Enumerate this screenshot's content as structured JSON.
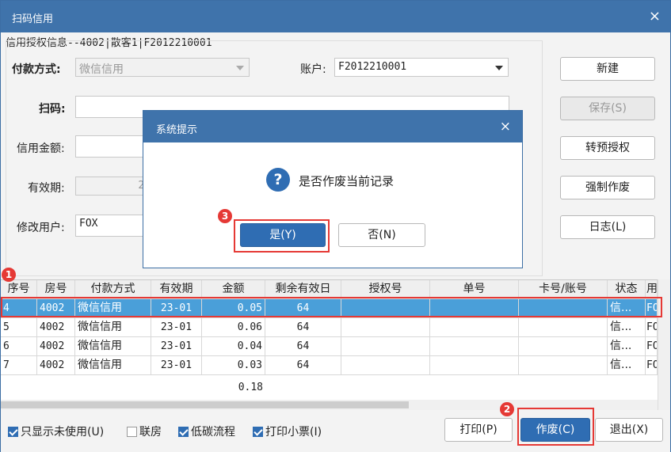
{
  "window": {
    "title": "扫码信用",
    "close": "×"
  },
  "subheader": "信用授权信息--4002|散客1|F2012210001",
  "form": {
    "pay_method_label": "付款方式:",
    "pay_method_value": "微信信用",
    "account_label": "账户:",
    "account_value": "F2012210001",
    "scan_label": "扫码:",
    "scan_value": "",
    "credit_amount_label": "信用金额:",
    "credit_amount_value": "",
    "validity_label": "有效期:",
    "validity_value": "20",
    "modify_user_label": "修改用户:",
    "modify_user_value": "FOX"
  },
  "side_buttons": {
    "new": "新建",
    "save": "保存(S)",
    "pre_auth": "转预授权",
    "force_void": "强制作废",
    "log": "日志(L)"
  },
  "grid": {
    "headers": [
      "序号",
      "房号",
      "付款方式",
      "有效期",
      "金额",
      "剩余有效日",
      "授权号",
      "单号",
      "卡号/账号",
      "状态",
      "用"
    ],
    "rows": [
      [
        "4",
        "4002",
        "微信信用",
        "23-01",
        "0.05",
        "64",
        "",
        "",
        "",
        "信...",
        "FO"
      ],
      [
        "5",
        "4002",
        "微信信用",
        "23-01",
        "0.06",
        "64",
        "",
        "",
        "",
        "信...",
        "FO"
      ],
      [
        "6",
        "4002",
        "微信信用",
        "23-01",
        "0.04",
        "64",
        "",
        "",
        "",
        "信...",
        "FO"
      ],
      [
        "7",
        "4002",
        "微信信用",
        "23-01",
        "0.03",
        "64",
        "",
        "",
        "",
        "信...",
        "FO"
      ]
    ],
    "total": "0.18"
  },
  "footer": {
    "only_unused": "只显示未使用(U)",
    "linked_room": "联房",
    "low_carbon": "低碳流程",
    "print_ticket": "打印小票(I)",
    "print": "打印(P)",
    "void": "作废(C)",
    "exit": "退出(X)"
  },
  "dialog": {
    "title": "系统提示",
    "close": "×",
    "icon": "?",
    "message": "是否作废当前记录",
    "yes": "是(Y)",
    "no": "否(N)"
  },
  "annotations": {
    "b1": "1",
    "b2": "2",
    "b3": "3"
  },
  "colors": {
    "titlebar": "#3f73ab",
    "accent": "#2f6db3",
    "selected_row": "#4a9fd9",
    "highlight": "#e53935"
  }
}
